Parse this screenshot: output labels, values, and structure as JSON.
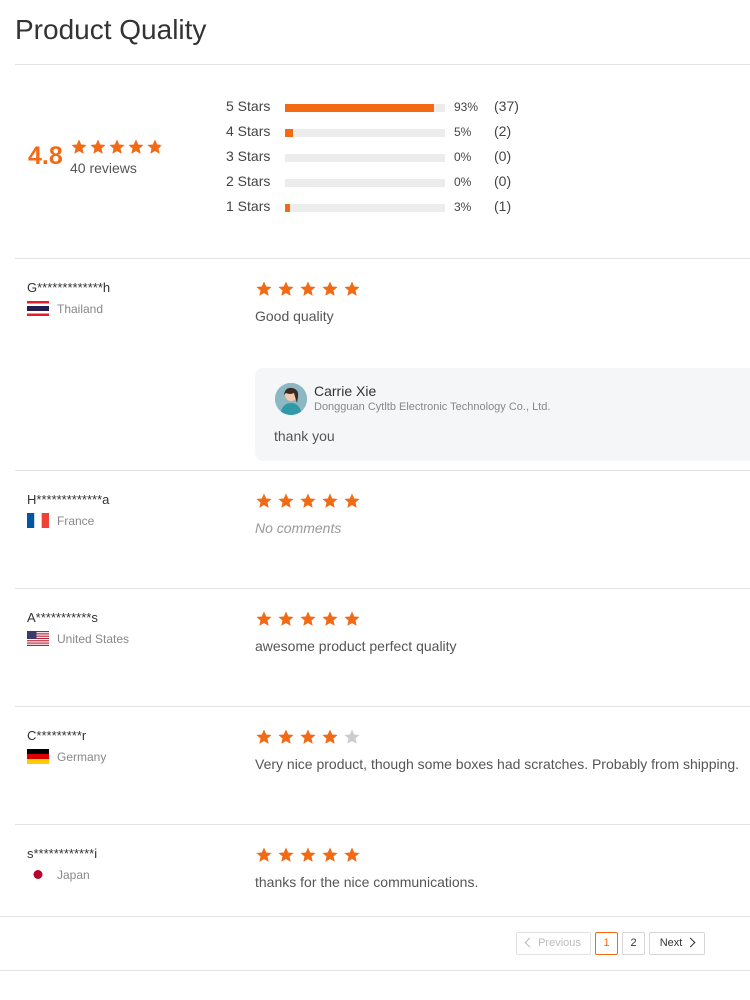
{
  "page": {
    "title": "Product Quality"
  },
  "summary": {
    "average": "4.8",
    "average_value": 4.8,
    "reviews_text": "40 reviews"
  },
  "breakdown": [
    {
      "label": "5 Stars",
      "percent_text": "93%",
      "count_text": "(37)",
      "fraction": 0.93
    },
    {
      "label": "4 Stars",
      "percent_text": "5%",
      "count_text": "(2)",
      "fraction": 0.05
    },
    {
      "label": "3 Stars",
      "percent_text": "0%",
      "count_text": "(0)",
      "fraction": 0.0
    },
    {
      "label": "2 Stars",
      "percent_text": "0%",
      "count_text": "(0)",
      "fraction": 0.0
    },
    {
      "label": "1 Stars",
      "percent_text": "3%",
      "count_text": "(1)",
      "fraction": 0.03
    }
  ],
  "reviews": [
    {
      "name": "G*************h",
      "country": "Thailand",
      "flag": "thailand-flag-icon",
      "rating": 5,
      "text": "Good quality",
      "empty": false
    },
    {
      "name": "H*************a",
      "country": "France",
      "flag": "france-flag-icon",
      "rating": 5,
      "text": "No comments",
      "empty": true
    },
    {
      "name": "A***********s",
      "country": "United States",
      "flag": "usa-flag-icon",
      "rating": 5,
      "text": "awesome product perfect quality",
      "empty": false
    },
    {
      "name": "C*********r",
      "country": "Germany",
      "flag": "germany-flag-icon",
      "rating": 4,
      "text": "Very nice product, though some boxes had scratches. Probably from shipping.",
      "empty": false
    },
    {
      "name": "s************i",
      "country": "Japan",
      "flag": "japan-flag-icon",
      "rating": 5,
      "text": "thanks for the nice communications.",
      "empty": false
    }
  ],
  "reply": {
    "name": "Carrie Xie",
    "company": "Dongguan Cytltb Electronic Technology Co., Ltd.",
    "text": "thank you",
    "avatar": "avatar-icon"
  },
  "pagination": {
    "previous_label": "Previous",
    "next_label": "Next",
    "pages": [
      "1",
      "2"
    ],
    "current_page": "1",
    "previous_disabled": true
  },
  "colors": {
    "accent": "#f26a13",
    "star_empty": "#cccccc",
    "bar_track": "#ececec",
    "reply_bg": "#f5f6f8"
  }
}
